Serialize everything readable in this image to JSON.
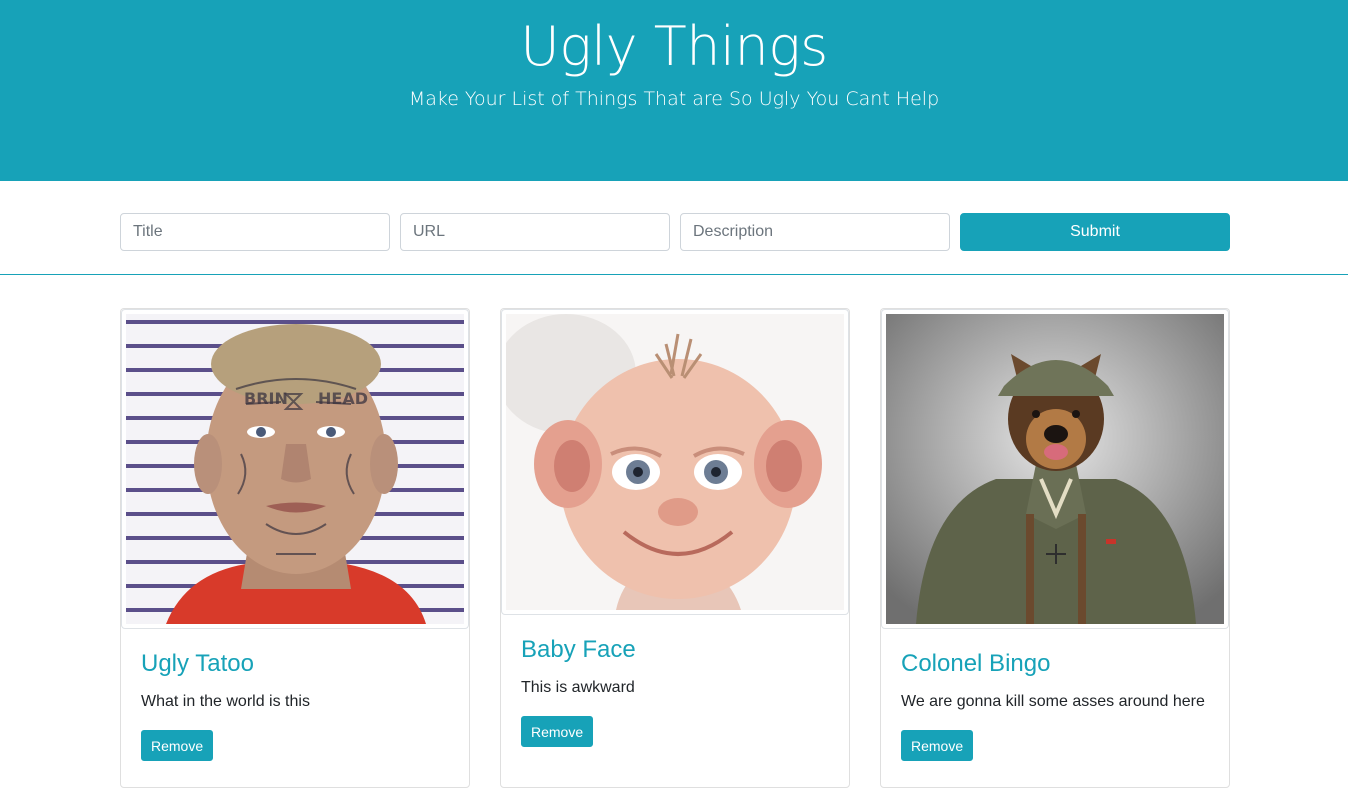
{
  "header": {
    "title": "Ugly Things",
    "subtitle": "Make Your List of Things That are So Ugly You Cant Help"
  },
  "form": {
    "title_placeholder": "Title",
    "url_placeholder": "URL",
    "description_placeholder": "Description",
    "submit_label": "Submit"
  },
  "cards": [
    {
      "title": "Ugly Tatoo",
      "description": "What in the world is this",
      "remove_label": "Remove",
      "image_icon": "tattooed-man-mugshot-photo"
    },
    {
      "title": "Baby Face",
      "description": "This is awkward",
      "remove_label": "Remove",
      "image_icon": "baby-face-photo"
    },
    {
      "title": "Colonel Bingo",
      "description": "We are gonna kill some asses around here",
      "remove_label": "Remove",
      "image_icon": "dog-in-uniform-photo"
    }
  ],
  "colors": {
    "accent": "#17a2b8",
    "page_background": "#ffffff",
    "text": "#212529"
  }
}
